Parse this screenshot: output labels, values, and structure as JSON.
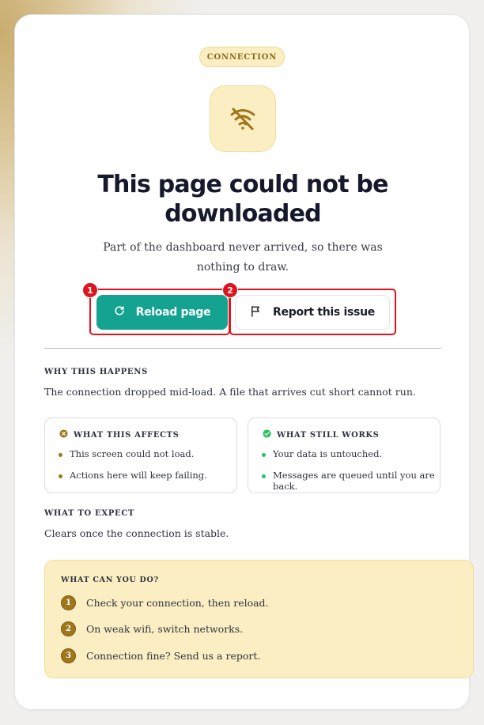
{
  "badge": "CONNECTION",
  "title": "This page could not be downloaded",
  "subtitle": "Part of the dashboard never arrived, so there was nothing to draw.",
  "actions": {
    "reload_label": "Reload page",
    "report_label": "Report this issue",
    "marker_1": "1",
    "marker_2": "2"
  },
  "why": {
    "heading": "WHY THIS HAPPENS",
    "text": "The connection dropped mid-load. A file that arrives cut short cannot run."
  },
  "affects": {
    "heading": "WHAT THIS AFFECTS",
    "items": [
      "This screen could not load.",
      "Actions here will keep failing."
    ]
  },
  "works": {
    "heading": "WHAT STILL WORKS",
    "items": [
      "Your data is untouched.",
      "Messages are queued until you are back."
    ]
  },
  "expect": {
    "heading": "WHAT TO EXPECT",
    "text": "Clears once the connection is stable."
  },
  "todo": {
    "heading": "WHAT CAN YOU DO?",
    "steps": [
      {
        "num": "1",
        "text": "Check your connection, then reload."
      },
      {
        "num": "2",
        "text": "On weak wifi, switch networks."
      },
      {
        "num": "3",
        "text": "Connection fine? Send us a report."
      }
    ]
  },
  "colors": {
    "accent": "#14a390",
    "warning_bg": "#fbeec2",
    "highlight": "#e0141e",
    "ok_green": "#22c55e",
    "error_brown": "#a0761a"
  },
  "icons": {
    "hero": "wifi-off-icon",
    "reload": "refresh-icon",
    "report": "flag-icon",
    "affects": "x-circle-icon",
    "works": "check-circle-icon"
  }
}
